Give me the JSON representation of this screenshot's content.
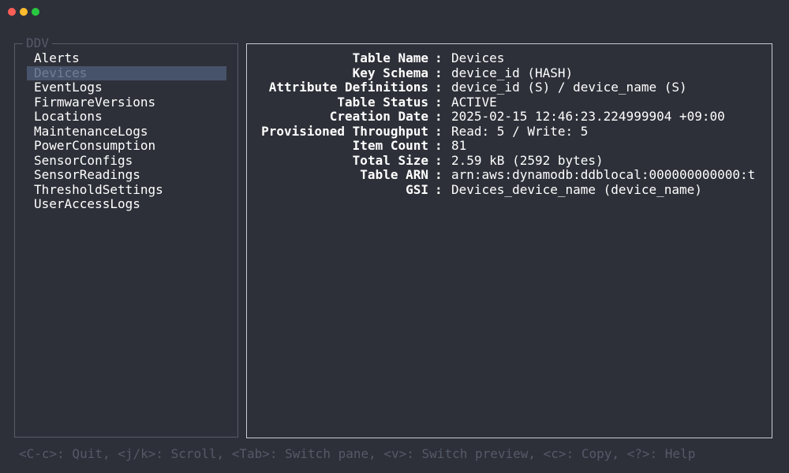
{
  "left_pane": {
    "title": "DDV",
    "selected_index": 1,
    "tables": [
      "Alerts",
      "Devices",
      "EventLogs",
      "FirmwareVersions",
      "Locations",
      "MaintenanceLogs",
      "PowerConsumption",
      "SensorConfigs",
      "SensorReadings",
      "ThresholdSettings",
      "UserAccessLogs"
    ]
  },
  "details": {
    "separator": ":",
    "rows": [
      {
        "key": "Table Name",
        "value": "Devices"
      },
      {
        "key": "Key Schema",
        "value": "device_id (HASH)"
      },
      {
        "key": "Attribute Definitions",
        "value": "device_id (S) / device_name (S)"
      },
      {
        "key": "Table Status",
        "value": "ACTIVE"
      },
      {
        "key": "Creation Date",
        "value": "2025-02-15 12:46:23.224999904 +09:00"
      },
      {
        "key": "Provisioned Throughput",
        "value": "Read: 5 / Write: 5"
      },
      {
        "key": "Item Count",
        "value": "81"
      },
      {
        "key": "Total Size",
        "value": "2.59 kB (2592 bytes)"
      },
      {
        "key": "Table ARN",
        "value": "arn:aws:dynamodb:ddblocal:000000000000:t"
      },
      {
        "key": "GSI",
        "value": "Devices_device_name (device_name)"
      }
    ]
  },
  "help_bar": {
    "text": "<C-c>: Quit, <j/k>: Scroll, <Tab>: Switch pane, <v>: Switch preview, <c>: Copy, <?>: Help"
  },
  "colors": {
    "background": "#2e3039",
    "selection": "#47536a",
    "muted_text": "#545a68",
    "active_border": "#c9ccd4"
  }
}
